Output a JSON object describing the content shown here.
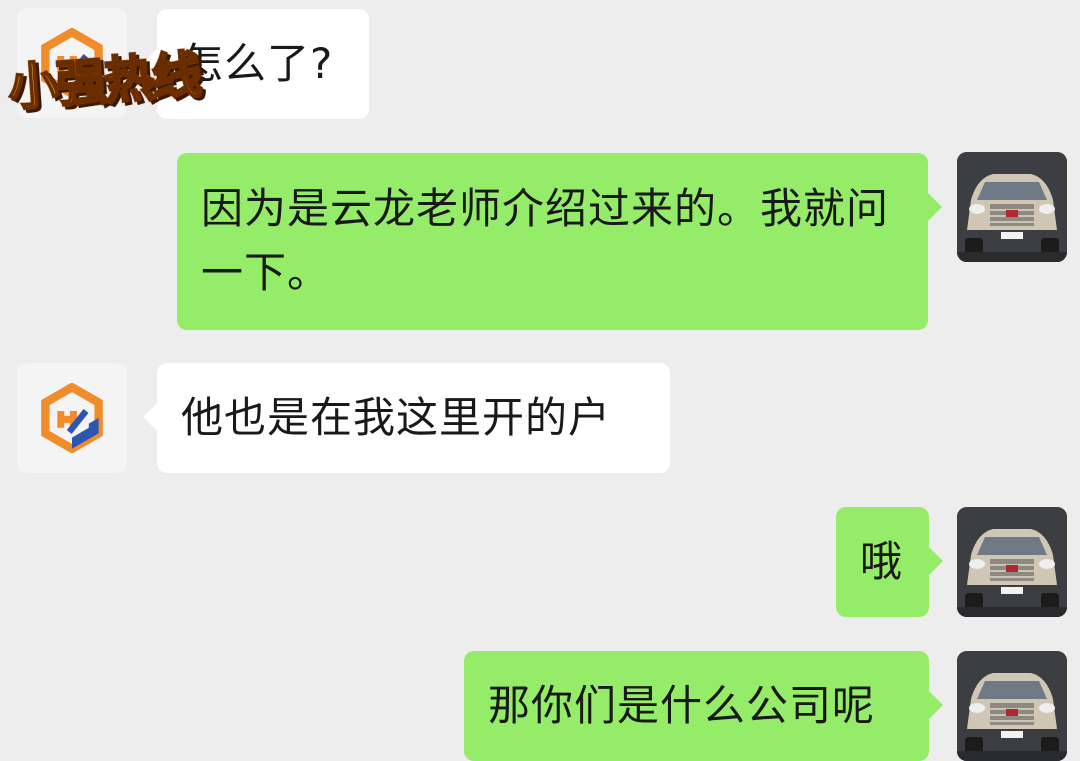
{
  "colors": {
    "background": "#ededed",
    "incoming_bubble": "#ffffff",
    "outgoing_bubble": "#95ec69",
    "text": "#191919"
  },
  "watermark": {
    "text": "小强热线"
  },
  "messages": [
    {
      "direction": "incoming",
      "avatar": "company-logo-icon",
      "text": "怎么了?"
    },
    {
      "direction": "outgoing",
      "avatar": "car-photo-avatar",
      "text": "因为是云龙老师介绍过来的。我就问一下。"
    },
    {
      "direction": "incoming",
      "avatar": "company-logo-icon",
      "text": "他也是在我这里开的户"
    },
    {
      "direction": "outgoing",
      "avatar": "car-photo-avatar",
      "text": "哦"
    },
    {
      "direction": "outgoing",
      "avatar": "car-photo-avatar",
      "text": "那你们是什么公司呢"
    }
  ]
}
